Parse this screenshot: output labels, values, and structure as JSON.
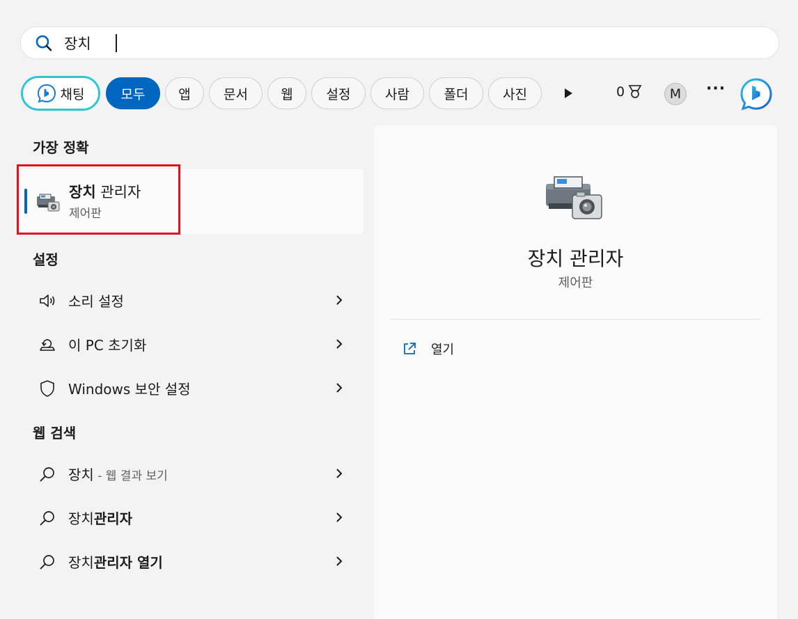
{
  "search": {
    "query": "장치"
  },
  "filters": {
    "chat_label": "채팅",
    "tabs": [
      {
        "label": "모두",
        "active": true
      },
      {
        "label": "앱"
      },
      {
        "label": "문서"
      },
      {
        "label": "웹"
      },
      {
        "label": "설정"
      },
      {
        "label": "사람"
      },
      {
        "label": "폴더"
      },
      {
        "label": "사진"
      }
    ],
    "rewards_points": "0",
    "avatar_initial": "M",
    "more_label": "···"
  },
  "best_match": {
    "section_title": "가장 정확",
    "title_bold": "장치",
    "title_rest": " 관리자",
    "subtitle": "제어판"
  },
  "settings": {
    "section_title": "설정",
    "items": [
      {
        "label": "소리 설정",
        "icon": "speaker-icon"
      },
      {
        "label": "이 PC 초기화",
        "icon": "reset-pc-icon"
      },
      {
        "label": "Windows 보안 설정",
        "icon": "shield-icon"
      }
    ]
  },
  "web": {
    "section_title": "웹 검색",
    "items": [
      {
        "plain": "장치",
        "bold": "",
        "suffix": " - 웹 결과 보기"
      },
      {
        "plain": "장치",
        "bold": "관리자",
        "suffix": ""
      },
      {
        "plain": "장치",
        "bold": "관리자 열기",
        "suffix": ""
      }
    ]
  },
  "preview": {
    "title": "장치 관리자",
    "subtitle": "제어판",
    "action_open": "열기"
  },
  "colors": {
    "accent": "#0067c0",
    "highlight_box": "#e0141e",
    "chat_border": "#2fc5d6"
  }
}
